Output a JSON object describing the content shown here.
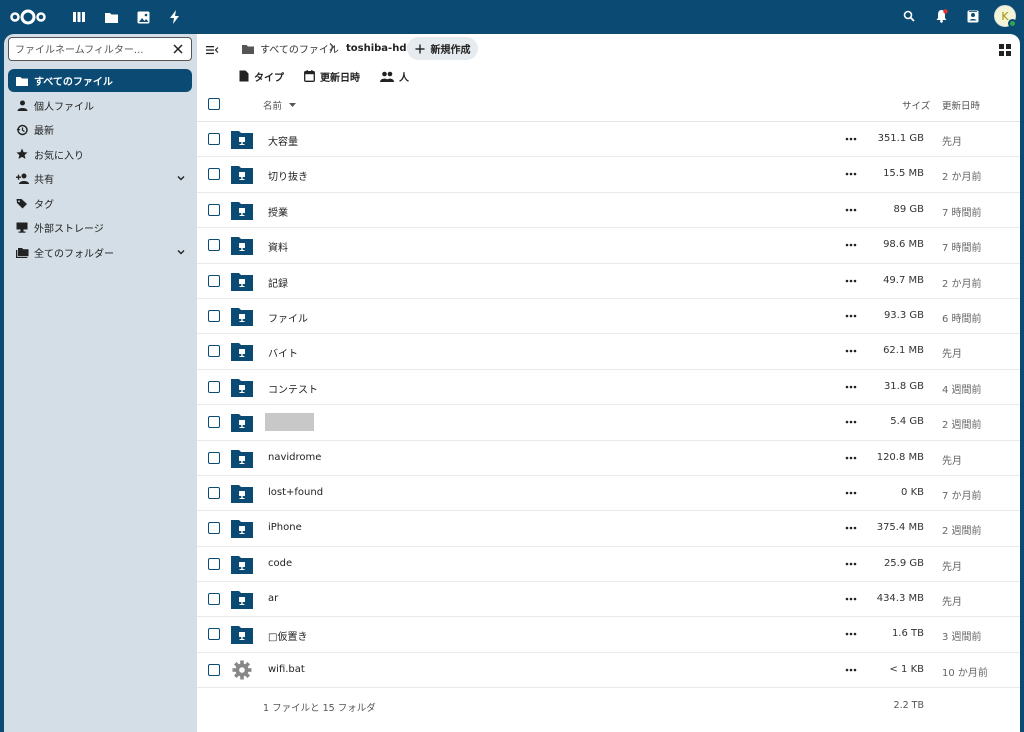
{
  "topbar": {
    "apps": [
      {
        "icon": "dashboard-icon"
      },
      {
        "icon": "files-icon"
      },
      {
        "icon": "photos-icon"
      },
      {
        "icon": "activity-icon"
      }
    ],
    "avatar_letter": "K"
  },
  "sidebar": {
    "filter_placeholder": "ファイルネームフィルター...",
    "items": [
      {
        "label": "すべてのファイル",
        "icon": "folder-icon",
        "active": true
      },
      {
        "label": "個人ファイル",
        "icon": "person-icon"
      },
      {
        "label": "最新",
        "icon": "history-icon"
      },
      {
        "label": "お気に入り",
        "icon": "star-icon"
      },
      {
        "label": "共有",
        "icon": "share-icon",
        "expandable": true
      },
      {
        "label": "タグ",
        "icon": "tag-icon"
      },
      {
        "label": "外部ストレージ",
        "icon": "external-storage-icon"
      },
      {
        "label": "全てのフォルダー",
        "icon": "folders-icon",
        "expandable": true
      }
    ]
  },
  "breadcrumb": {
    "home": "すべてのファイル",
    "current": "toshiba-hdd",
    "new_button": "新規作成"
  },
  "filters": {
    "type": "タイプ",
    "modified": "更新日時",
    "people": "人"
  },
  "table": {
    "headers": {
      "name": "名前",
      "size": "サイズ",
      "modified": "更新日時"
    },
    "rows": [
      {
        "name": "大容量",
        "size": "351.1 GB",
        "modified": "先月",
        "kind": "folder"
      },
      {
        "name": "切り抜き",
        "size": "15.5 MB",
        "modified": "2 か月前",
        "kind": "folder"
      },
      {
        "name": "授業",
        "size": "89 GB",
        "modified": "7 時間前",
        "kind": "folder"
      },
      {
        "name": "資料",
        "size": "98.6 MB",
        "modified": "7 時間前",
        "kind": "folder"
      },
      {
        "name": "記録",
        "size": "49.7 MB",
        "modified": "2 か月前",
        "kind": "folder"
      },
      {
        "name": "ファイル",
        "size": "93.3 GB",
        "modified": "6 時間前",
        "kind": "folder"
      },
      {
        "name": "バイト",
        "size": "62.1 MB",
        "modified": "先月",
        "kind": "folder"
      },
      {
        "name": "コンテスト",
        "size": "31.8 GB",
        "modified": "4 週間前",
        "kind": "folder"
      },
      {
        "name": "",
        "size": "5.4 GB",
        "modified": "2 週間前",
        "kind": "folder",
        "redacted": true
      },
      {
        "name": "navidrome",
        "size": "120.8 MB",
        "modified": "先月",
        "kind": "folder"
      },
      {
        "name": "lost+found",
        "size": "0 KB",
        "modified": "7 か月前",
        "kind": "folder"
      },
      {
        "name": "iPhone",
        "size": "375.4 MB",
        "modified": "2 週間前",
        "kind": "folder"
      },
      {
        "name": "code",
        "size": "25.9 GB",
        "modified": "先月",
        "kind": "folder"
      },
      {
        "name": "ar",
        "size": "434.3 MB",
        "modified": "先月",
        "kind": "folder"
      },
      {
        "name": "□仮置き",
        "size": "1.6 TB",
        "modified": "3 週間前",
        "kind": "folder"
      },
      {
        "name": "wifi.bat",
        "size": "< 1 KB",
        "modified": "10 か月前",
        "kind": "file"
      }
    ],
    "summary": "1 ファイルと 15 フォルダ",
    "total_size": "2.2 TB"
  },
  "colors": {
    "brand": "#0b4a72",
    "sidebar": "#d3dee6"
  }
}
